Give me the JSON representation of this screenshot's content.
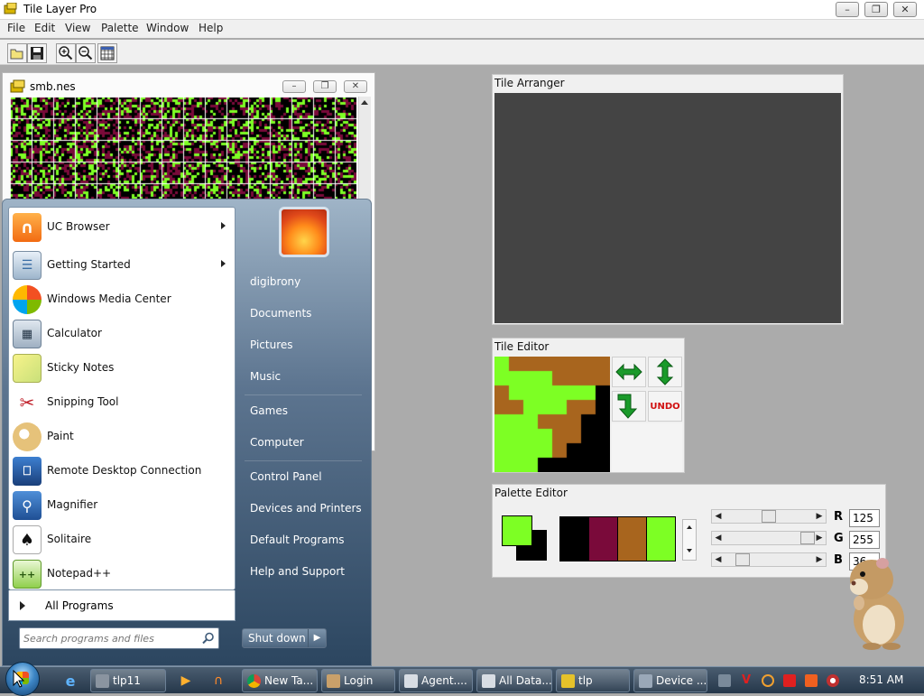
{
  "app": {
    "title": "Tile Layer Pro"
  },
  "menu": [
    "File",
    "Edit",
    "View",
    "Palette",
    "Window",
    "Help"
  ],
  "rom_window": {
    "title": "smb.nes"
  },
  "windows": {
    "tile_arranger": "Tile Arranger",
    "tile_editor": "Tile Editor",
    "palette_editor": "Palette Editor"
  },
  "tile_editor": {
    "undo_label": "UNDO"
  },
  "palette_editor": {
    "r_label": "R",
    "g_label": "G",
    "b_label": "B",
    "r": "125",
    "g": "255",
    "b": "36",
    "r_fraction": 0.49,
    "g_fraction": 1.0,
    "b_fraction": 0.14,
    "swatches": [
      "#000000",
      "#7a0a3a",
      "#a8651e",
      "#7dff24"
    ]
  },
  "start_menu": {
    "programs": [
      {
        "label": "UC Browser",
        "icon": "uc-browser-icon",
        "submenu": true
      },
      {
        "label": "Getting Started",
        "icon": "getting-started-icon",
        "submenu": true
      },
      {
        "label": "Windows Media Center",
        "icon": "media-center-icon",
        "submenu": false
      },
      {
        "label": "Calculator",
        "icon": "calculator-icon",
        "submenu": false
      },
      {
        "label": "Sticky Notes",
        "icon": "sticky-notes-icon",
        "submenu": false
      },
      {
        "label": "Snipping Tool",
        "icon": "snipping-tool-icon",
        "submenu": false
      },
      {
        "label": "Paint",
        "icon": "paint-icon",
        "submenu": false
      },
      {
        "label": "Remote Desktop Connection",
        "icon": "remote-desktop-icon",
        "submenu": false
      },
      {
        "label": "Magnifier",
        "icon": "magnifier-icon",
        "submenu": false
      },
      {
        "label": "Solitaire",
        "icon": "solitaire-icon",
        "submenu": false
      },
      {
        "label": "Notepad++",
        "icon": "notepad-plus-icon",
        "submenu": false
      }
    ],
    "all_programs": "All Programs",
    "search_placeholder": "Search programs and files",
    "right_links": [
      "digibrony",
      "Documents",
      "Pictures",
      "Music",
      "Games",
      "Computer",
      "Control Panel",
      "Devices and Printers",
      "Default Programs",
      "Help and Support"
    ],
    "shutdown": "Shut down"
  },
  "taskbar": {
    "items": [
      "tlp11",
      "New Ta...",
      "Login",
      "Agent....",
      "All Data...",
      "tlp",
      "Device ..."
    ],
    "clock": "8:51 AM"
  },
  "colors": {
    "green": "#7dff24",
    "brown": "#a8651e",
    "maroon": "#7a0a3a",
    "canvas": "#444444"
  }
}
